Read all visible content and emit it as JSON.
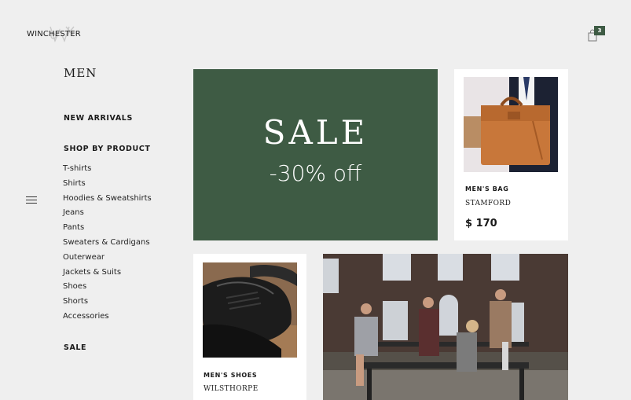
{
  "brand": {
    "name": "WINCHESTER"
  },
  "cart": {
    "count": "3"
  },
  "nav": {
    "title": "MEN",
    "new_arrivals": "NEW ARRIVALS",
    "shop_by_product": "SHOP BY PRODUCT",
    "items": [
      "T-shirts",
      "Shirts",
      "Hoodies & Sweatshirts",
      "Jeans",
      "Pants",
      "Sweaters & Cardigans",
      "Outerwear",
      "Jackets & Suits",
      "Shoes",
      "Shorts",
      "Accessories"
    ],
    "sale": "SALE"
  },
  "promo": {
    "title": "SALE",
    "subtitle": "-30% off"
  },
  "products": [
    {
      "category": "MEN'S BAG",
      "name": "STAMFORD",
      "price": "$ 170"
    },
    {
      "category": "MEN'S SHOES",
      "name": "WILSTHORPE"
    }
  ],
  "colors": {
    "accent": "#3e5b44",
    "background": "#efefef"
  }
}
